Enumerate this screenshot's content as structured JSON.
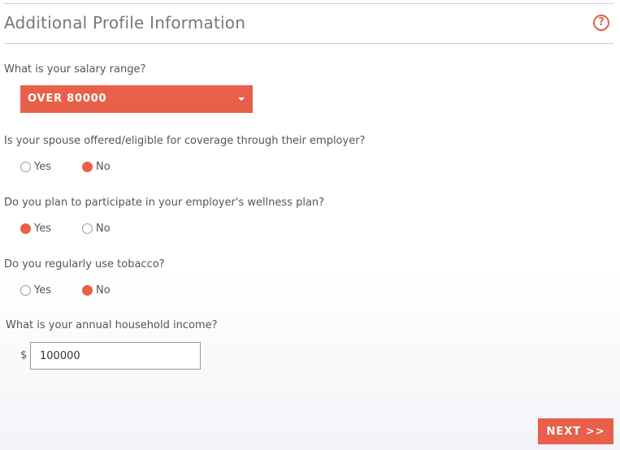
{
  "header": {
    "title": "Additional Profile Information",
    "help_icon": "question-circle-icon",
    "help_glyph": "?"
  },
  "salary": {
    "question": "What is your salary range?",
    "selected": "OVER 80000"
  },
  "spouse": {
    "question": "Is your spouse offered/eligible for coverage through their employer?",
    "options": [
      "Yes",
      "No"
    ],
    "selected": "No"
  },
  "wellness": {
    "question": "Do you plan to participate in your employer's wellness plan?",
    "options": [
      "Yes",
      "No"
    ],
    "selected": "Yes"
  },
  "tobacco": {
    "question": "Do you regularly use tobacco?",
    "options": [
      "Yes",
      "No"
    ],
    "selected": "No"
  },
  "income": {
    "question": "What is your annual household income?",
    "currency": "$",
    "value": "100000"
  },
  "footer": {
    "next_label": "NEXT >>"
  },
  "colors": {
    "accent": "#e8604a",
    "text": "#555555",
    "rule": "#cfcfcf"
  }
}
